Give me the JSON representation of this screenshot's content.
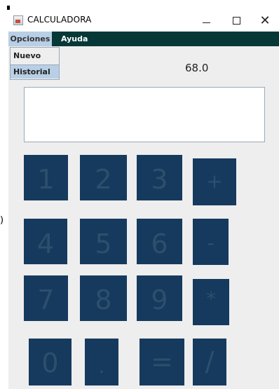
{
  "window": {
    "title": "CALCULADORA",
    "controls": {
      "minimize": "–",
      "close": "✕"
    }
  },
  "menubar": {
    "menus": [
      "Opciones",
      "Ayuda"
    ]
  },
  "dropdown": {
    "items": [
      "Nuevo",
      "Historial"
    ],
    "highlighted": "Historial"
  },
  "display": {
    "result": "68.0",
    "input_value": ""
  },
  "keypad": {
    "row1": [
      "1",
      "2",
      "3",
      "+"
    ],
    "row2": [
      "4",
      "5",
      "6",
      "-"
    ],
    "row3": [
      "7",
      "8",
      "9",
      "*"
    ],
    "row4": [
      "0",
      ".",
      "=",
      "/"
    ]
  },
  "outside_text": ")",
  "colors": {
    "menubar_bg": "#063837",
    "menu_selected_bg": "#b8cfe5",
    "key_bg": "#163a5e",
    "key_text": "#2d4f6b",
    "window_bg": "#eeeeee"
  }
}
